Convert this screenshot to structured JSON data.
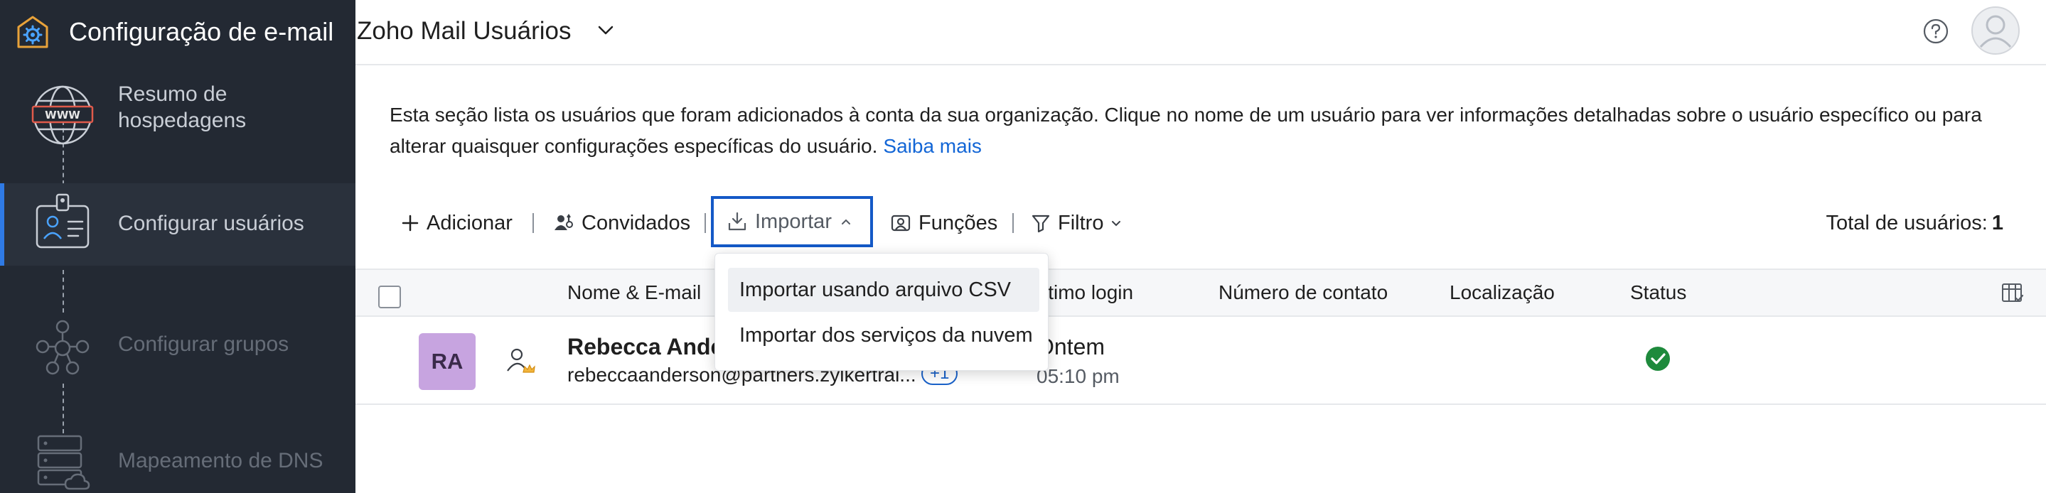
{
  "app": {
    "title": "Configuração de e-mail"
  },
  "sidebar": {
    "steps": [
      {
        "label": "Resumo de hospedagens",
        "state": "done",
        "icon": "www-globe-icon"
      },
      {
        "label": "Configurar usuários",
        "state": "active",
        "icon": "user-id-card-icon"
      },
      {
        "label": "Configurar grupos",
        "state": "disabled",
        "icon": "group-network-icon"
      },
      {
        "label": "Mapeamento de DNS",
        "state": "disabled",
        "icon": "dns-server-icon"
      }
    ]
  },
  "header": {
    "title": "Zoho Mail Usuários",
    "help_icon": "help-circle-icon",
    "avatar_icon": "user-avatar-icon"
  },
  "main": {
    "description": "Esta seção lista os usuários que foram adicionados à conta da sua organização. Clique no nome de um usuário para ver informações detalhadas sobre o usuário específico ou para alterar quaisquer configurações específicas do usuário.",
    "learn_more": "Saiba mais",
    "toolbar": {
      "add": "Adicionar",
      "invited": "Convidados",
      "import": "Importar",
      "roles": "Funções",
      "filter": "Filtro",
      "total_label": "Total de usuários:",
      "total_value": "1"
    },
    "import_menu": [
      "Importar usando arquivo CSV",
      "Importar dos serviços da nuvem"
    ],
    "table": {
      "columns": {
        "name": "Nome & E-mail",
        "last_login": "Último login",
        "last_login_visible": "ltimo login",
        "phone": "Número de contato",
        "location": "Localização",
        "status": "Status"
      },
      "rows": [
        {
          "initials": "RA",
          "name": "Rebecca Anderson",
          "name_visible": "Rebecca Ande",
          "email": "rebeccaanderson@partners.zylkertrai...",
          "extra_badge": "+1",
          "last_login_day": "Ontem",
          "last_login_time": "05:10 pm",
          "phone": "",
          "location": "",
          "status": "active"
        }
      ]
    }
  },
  "colors": {
    "sidebar_bg": "#232933",
    "accent": "#1459c7",
    "link": "#1366d6",
    "avatar_bg": "#c7a4e0",
    "status_ok": "#1e8a3c"
  }
}
